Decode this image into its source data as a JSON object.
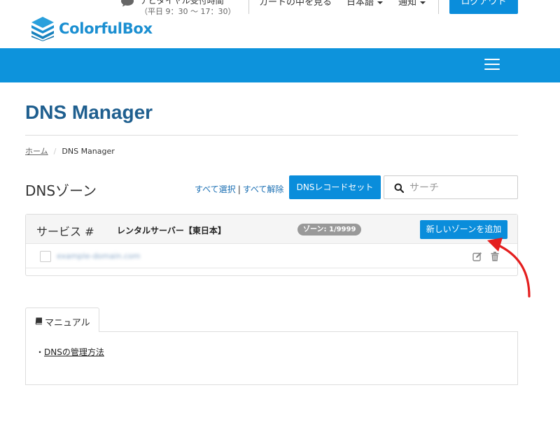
{
  "header": {
    "support_title": "ナビダイヤル受付時間",
    "support_hours": "（平日 9：30 〜 17：30）",
    "cart_label": "カートの中を見る",
    "language_label": "日本語",
    "notice_label": "通知",
    "logout_label": "ログアウト",
    "logo_text": "ColorfulBox",
    "brand_color": "#0d93dc"
  },
  "page": {
    "title": "DNS Manager",
    "breadcrumb": {
      "home": "ホーム",
      "current": "DNS Manager"
    }
  },
  "zones": {
    "heading": "DNSゾーン",
    "select_all": "すべて選択",
    "deselect_all": "すべて解除",
    "recordset_button": "DNSレコードセット",
    "search_placeholder": "サーチ",
    "service_label": "サービス #",
    "service_name": "レンタルサーバー【東日本】",
    "zone_badge": "ゾーン: 1/9999",
    "add_zone_button": "新しいゾーンを追加",
    "rows": [
      {
        "domain": "example-domain.com"
      }
    ]
  },
  "manual": {
    "tab_label": "マニュアル",
    "link_prefix": "・",
    "link_text": "DNSの管理方法"
  }
}
